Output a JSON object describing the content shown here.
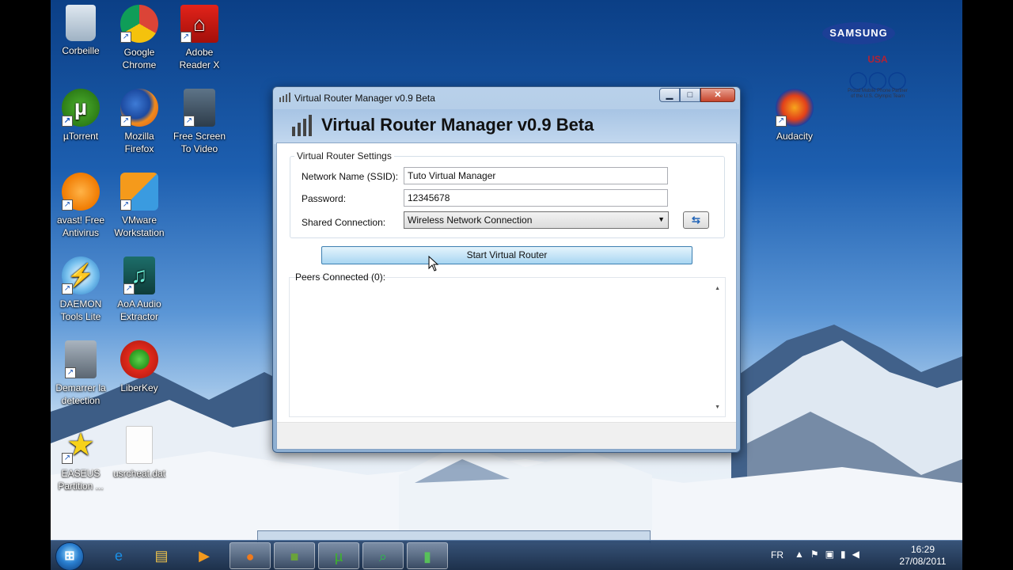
{
  "desktop": {
    "icons": [
      {
        "label_line1": "Corbeille",
        "label_line2": ""
      },
      {
        "label_line1": "Google",
        "label_line2": "Chrome"
      },
      {
        "label_line1": "Adobe",
        "label_line2": "Reader X"
      },
      {
        "label_line1": "µTorrent",
        "label_line2": ""
      },
      {
        "label_line1": "Mozilla",
        "label_line2": "Firefox"
      },
      {
        "label_line1": "Free Screen",
        "label_line2": "To Video"
      },
      {
        "label_line1": "avast! Free",
        "label_line2": "Antivirus"
      },
      {
        "label_line1": "VMware",
        "label_line2": "Workstation"
      },
      {
        "label_line1": "DAEMON",
        "label_line2": "Tools Lite"
      },
      {
        "label_line1": "AoA Audio",
        "label_line2": "Extractor"
      },
      {
        "label_line1": "Demarrer la",
        "label_line2": "detection"
      },
      {
        "label_line1": "LiberKey",
        "label_line2": ""
      },
      {
        "label_line1": "EASEUS",
        "label_line2": "Partition ..."
      },
      {
        "label_line1": "usrcheat.dat",
        "label_line2": ""
      },
      {
        "label_line1": "Audacity",
        "label_line2": ""
      }
    ],
    "brand": {
      "samsung": "SAMSUNG",
      "usa": "USA",
      "usa_sub1": "Proud Mobile Phone Partner",
      "usa_sub2": "of the U.S. Olympic Team"
    }
  },
  "window": {
    "title": "Virtual Router Manager v0.9 Beta",
    "header_title": "Virtual Router Manager v0.9 Beta",
    "buttons": {
      "minimize": "▁",
      "maximize": "□",
      "close": "✕"
    },
    "settings_group": "Virtual Router Settings",
    "ssid_label": "Network Name (SSID):",
    "ssid_value": "Tuto Virtual Manager",
    "password_label": "Password:",
    "password_value": "12345678",
    "shared_label": "Shared Connection:",
    "shared_value": "Wireless Network Connection",
    "refresh_icon": "refresh-icon",
    "start_button": "Start Virtual Router",
    "peers_label": "Peers Connected (0):"
  },
  "taskbar": {
    "language": "FR",
    "time": "16:29",
    "date": "27/08/2011",
    "items": [
      "start-orb",
      "internet-explorer",
      "file-explorer",
      "media-player",
      "firefox",
      "minecraft",
      "utorrent",
      "search-app",
      "virtual-router-manager"
    ]
  },
  "colors": {
    "accent": "#2a7fd0",
    "titlebar": "#b9d1ea",
    "close": "#c6452d"
  }
}
